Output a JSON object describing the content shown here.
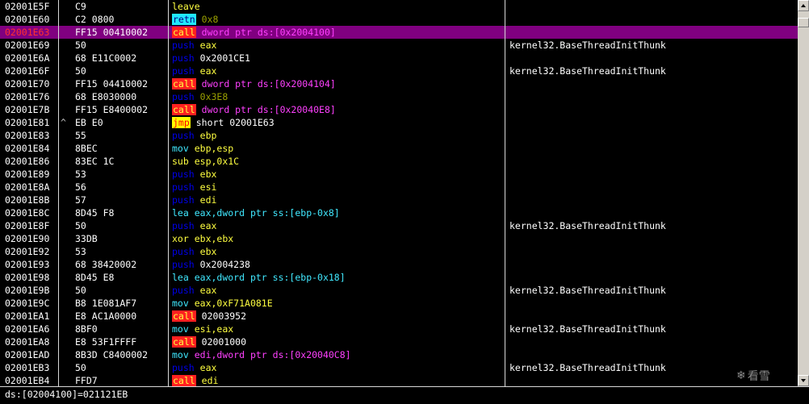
{
  "colors": {
    "background": "#000000",
    "text": "#ffffff",
    "selected_row": "#800080",
    "selected_address": "#ff3030",
    "mnemonic_push": "#0000e8",
    "mnemonic_flow": "#ffff40",
    "mnemonic_data": "#40e8ff",
    "operand_memory": "#ff40ff",
    "operand_register": "#ffff40",
    "operand_immediate": "#9aa000",
    "call_highlight_bg": "#ff2020",
    "jmp_highlight_bg": "#ffff00",
    "retn_highlight_bg": "#20e8ff"
  },
  "rows": [
    {
      "addr": "02001E5F",
      "mark": "",
      "hex": "C9",
      "mn": "leave",
      "mn_style": "flow",
      "op": "",
      "op_style": "",
      "cmt": ""
    },
    {
      "addr": "02001E60",
      "mark": "",
      "hex": "C2 0800",
      "mn": "retn",
      "mn_style": "retn-hl",
      "op": "0x8",
      "op_style": "imm",
      "cmt": ""
    },
    {
      "addr": "02001E63",
      "mark": "",
      "hex": "FF15 00410002",
      "mn": "call",
      "mn_style": "call-hl",
      "op": "dword ptr ds:[0x2004100]",
      "op_style": "mem",
      "cmt": "",
      "selected": true
    },
    {
      "addr": "02001E69",
      "mark": "",
      "hex": "50",
      "mn": "push",
      "mn_style": "push",
      "op": "eax",
      "op_style": "reg",
      "cmt": "kernel32.BaseThreadInitThunk"
    },
    {
      "addr": "02001E6A",
      "mark": "",
      "hex": "68 E11C0002",
      "mn": "push",
      "mn_style": "push",
      "op": "0x2001CE1",
      "op_style": "plain",
      "cmt": ""
    },
    {
      "addr": "02001E6F",
      "mark": "",
      "hex": "50",
      "mn": "push",
      "mn_style": "push",
      "op": "eax",
      "op_style": "reg",
      "cmt": "kernel32.BaseThreadInitThunk"
    },
    {
      "addr": "02001E70",
      "mark": "",
      "hex": "FF15 04410002",
      "mn": "call",
      "mn_style": "call-hl",
      "op": "dword ptr ds:[0x2004104]",
      "op_style": "mem",
      "cmt": ""
    },
    {
      "addr": "02001E76",
      "mark": "",
      "hex": "68 E8030000",
      "mn": "push",
      "mn_style": "push",
      "op": "0x3E8",
      "op_style": "imm",
      "cmt": ""
    },
    {
      "addr": "02001E7B",
      "mark": "",
      "hex": "FF15 E8400002",
      "mn": "call",
      "mn_style": "call-hl",
      "op": "dword ptr ds:[0x20040E8]",
      "op_style": "mem",
      "cmt": ""
    },
    {
      "addr": "02001E81",
      "mark": "^",
      "hex": "EB E0",
      "mn": "jmp",
      "mn_style": "jmp-hl",
      "op": "short 02001E63",
      "op_style": "plain",
      "cmt": ""
    },
    {
      "addr": "02001E83",
      "mark": "",
      "hex": "55",
      "mn": "push",
      "mn_style": "push",
      "op": "ebp",
      "op_style": "reg",
      "cmt": ""
    },
    {
      "addr": "02001E84",
      "mark": "",
      "hex": "8BEC",
      "mn": "mov",
      "mn_style": "data",
      "op": "ebp,esp",
      "op_style": "reg",
      "cmt": ""
    },
    {
      "addr": "02001E86",
      "mark": "",
      "hex": "83EC 1C",
      "mn": "sub",
      "mn_style": "flow",
      "op": "esp,0x1C",
      "op_style": "regimm",
      "cmt": ""
    },
    {
      "addr": "02001E89",
      "mark": "",
      "hex": "53",
      "mn": "push",
      "mn_style": "push",
      "op": "ebx",
      "op_style": "reg",
      "cmt": ""
    },
    {
      "addr": "02001E8A",
      "mark": "",
      "hex": "56",
      "mn": "push",
      "mn_style": "push",
      "op": "esi",
      "op_style": "reg",
      "cmt": ""
    },
    {
      "addr": "02001E8B",
      "mark": "",
      "hex": "57",
      "mn": "push",
      "mn_style": "push",
      "op": "edi",
      "op_style": "reg",
      "cmt": ""
    },
    {
      "addr": "02001E8C",
      "mark": "",
      "hex": "8D45 F8",
      "mn": "lea",
      "mn_style": "data",
      "op": "eax,dword ptr ss:[ebp-0x8]",
      "op_style": "data",
      "cmt": ""
    },
    {
      "addr": "02001E8F",
      "mark": "",
      "hex": "50",
      "mn": "push",
      "mn_style": "push",
      "op": "eax",
      "op_style": "reg",
      "cmt": "kernel32.BaseThreadInitThunk"
    },
    {
      "addr": "02001E90",
      "mark": "",
      "hex": "33DB",
      "mn": "xor",
      "mn_style": "flow",
      "op": "ebx,ebx",
      "op_style": "reg",
      "cmt": ""
    },
    {
      "addr": "02001E92",
      "mark": "",
      "hex": "53",
      "mn": "push",
      "mn_style": "push",
      "op": "ebx",
      "op_style": "reg",
      "cmt": ""
    },
    {
      "addr": "02001E93",
      "mark": "",
      "hex": "68 38420002",
      "mn": "push",
      "mn_style": "push",
      "op": "0x2004238",
      "op_style": "plain",
      "cmt": ""
    },
    {
      "addr": "02001E98",
      "mark": "",
      "hex": "8D45 E8",
      "mn": "lea",
      "mn_style": "data",
      "op": "eax,dword ptr ss:[ebp-0x18]",
      "op_style": "data",
      "cmt": ""
    },
    {
      "addr": "02001E9B",
      "mark": "",
      "hex": "50",
      "mn": "push",
      "mn_style": "push",
      "op": "eax",
      "op_style": "reg",
      "cmt": "kernel32.BaseThreadInitThunk"
    },
    {
      "addr": "02001E9C",
      "mark": "",
      "hex": "B8 1E081AF7",
      "mn": "mov",
      "mn_style": "data",
      "op": "eax,0xF71A081E",
      "op_style": "regimm",
      "cmt": ""
    },
    {
      "addr": "02001EA1",
      "mark": "",
      "hex": "E8 AC1A0000",
      "mn": "call",
      "mn_style": "call-hl",
      "op": "02003952",
      "op_style": "plain",
      "cmt": ""
    },
    {
      "addr": "02001EA6",
      "mark": "",
      "hex": "8BF0",
      "mn": "mov",
      "mn_style": "data",
      "op": "esi,eax",
      "op_style": "reg",
      "cmt": "kernel32.BaseThreadInitThunk"
    },
    {
      "addr": "02001EA8",
      "mark": "",
      "hex": "E8 53F1FFFF",
      "mn": "call",
      "mn_style": "call-hl",
      "op": "02001000",
      "op_style": "plain",
      "cmt": ""
    },
    {
      "addr": "02001EAD",
      "mark": "",
      "hex": "8B3D C8400002",
      "mn": "mov",
      "mn_style": "data",
      "op": "edi,dword ptr ds:[0x20040C8]",
      "op_style": "mem",
      "cmt": ""
    },
    {
      "addr": "02001EB3",
      "mark": "",
      "hex": "50",
      "mn": "push",
      "mn_style": "push",
      "op": "eax",
      "op_style": "reg",
      "cmt": "kernel32.BaseThreadInitThunk"
    },
    {
      "addr": "02001EB4",
      "mark": "",
      "hex": "FFD7",
      "mn": "call",
      "mn_style": "call-hl",
      "op": "edi",
      "op_style": "reg",
      "cmt": ""
    }
  ],
  "status": {
    "text": "ds:[02004100]=021121EB"
  },
  "watermark": {
    "text": "看雪",
    "icon": "snowflake-icon"
  }
}
